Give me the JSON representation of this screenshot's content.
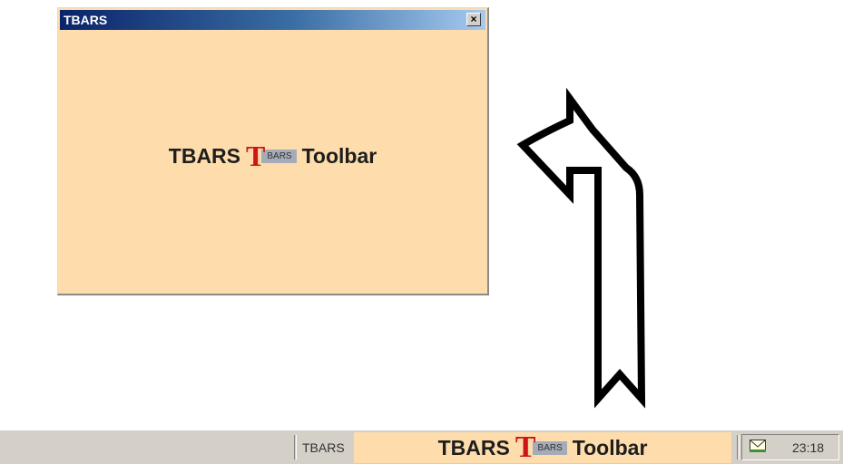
{
  "window": {
    "title": "TBARS",
    "close_glyph": "×",
    "content": {
      "left_word": "TBARS",
      "logo_letter": "T",
      "logo_sub": "BARS",
      "right_word": "Toolbar"
    }
  },
  "taskbar": {
    "button_label": "TBARS",
    "toolbar": {
      "left_word": "TBARS",
      "logo_letter": "T",
      "logo_sub": "BARS",
      "right_word": "Toolbar"
    },
    "tray": {
      "mail_icon": "envelope-icon",
      "clock": "23:18"
    }
  },
  "colors": {
    "window_bg": "#fedcab",
    "logo_red": "#d01414",
    "taskbar_bg": "#d4d0c8"
  }
}
